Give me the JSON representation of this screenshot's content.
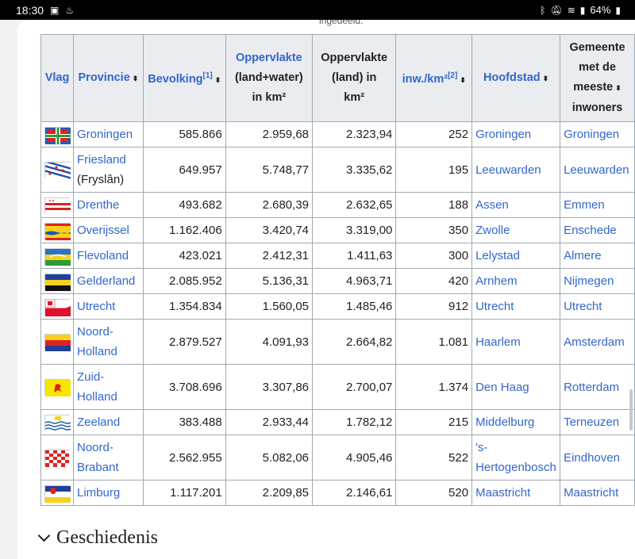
{
  "status_bar": {
    "time": "18:30",
    "battery": "64%"
  },
  "top_note": "ingedeeld.",
  "table": {
    "headers": {
      "vlag": "Vlag",
      "provincie": "Provincie",
      "bevolking": "Bevolking",
      "bevolking_ref": "[1]",
      "opp_total_1": "Oppervlakte",
      "opp_total_2": "(land+water)",
      "opp_total_3": "in km²",
      "opp_land_1": "Oppervlakte",
      "opp_land_2": "(land) in",
      "opp_land_3": "km²",
      "dichtheid": "inw./km²",
      "dichtheid_ref": "[2]",
      "hoofdstad": "Hoofdstad",
      "gemeente_1": "Gemeente",
      "gemeente_2": "met de",
      "gemeente_3": "meeste",
      "gemeente_4": "inwoners",
      "sort": "⬍"
    },
    "rows": [
      {
        "province": "Groningen",
        "province2": "",
        "pop": "585.866",
        "area_total": "2.959,68",
        "area_land": "2.323,94",
        "density": "252",
        "capital": "Groningen",
        "capital2": "",
        "largest": "Groningen"
      },
      {
        "province": "Friesland",
        "province2": "(Fryslân)",
        "pop": "649.957",
        "area_total": "5.748,77",
        "area_land": "3.335,62",
        "density": "195",
        "capital": "Leeuwarden",
        "capital2": "",
        "largest": "Leeuwarden"
      },
      {
        "province": "Drenthe",
        "province2": "",
        "pop": "493.682",
        "area_total": "2.680,39",
        "area_land": "2.632,65",
        "density": "188",
        "capital": "Assen",
        "capital2": "",
        "largest": "Emmen"
      },
      {
        "province": "Overijssel",
        "province2": "",
        "pop": "1.162.406",
        "area_total": "3.420,74",
        "area_land": "3.319,00",
        "density": "350",
        "capital": "Zwolle",
        "capital2": "",
        "largest": "Enschede"
      },
      {
        "province": "Flevoland",
        "province2": "",
        "pop": "423.021",
        "area_total": "2.412,31",
        "area_land": "1.411,63",
        "density": "300",
        "capital": "Lelystad",
        "capital2": "",
        "largest": "Almere"
      },
      {
        "province": "Gelderland",
        "province2": "",
        "pop": "2.085.952",
        "area_total": "5.136,31",
        "area_land": "4.963,71",
        "density": "420",
        "capital": "Arnhem",
        "capital2": "",
        "largest": "Nijmegen"
      },
      {
        "province": "Utrecht",
        "province2": "",
        "pop": "1.354.834",
        "area_total": "1.560,05",
        "area_land": "1.485,46",
        "density": "912",
        "capital": "Utrecht",
        "capital2": "",
        "largest": "Utrecht"
      },
      {
        "province": "Noord-",
        "province2": "Holland",
        "pop": "2.879.527",
        "area_total": "4.091,93",
        "area_land": "2.664,82",
        "density": "1.081",
        "capital": "Haarlem",
        "capital2": "",
        "largest": "Amsterdam"
      },
      {
        "province": "Zuid-",
        "province2": "Holland",
        "pop": "3.708.696",
        "area_total": "3.307,86",
        "area_land": "2.700,07",
        "density": "1.374",
        "capital": "Den Haag",
        "capital2": "",
        "largest": "Rotterdam"
      },
      {
        "province": "Zeeland",
        "province2": "",
        "pop": "383.488",
        "area_total": "2.933,44",
        "area_land": "1.782,12",
        "density": "215",
        "capital": "Middelburg",
        "capital2": "",
        "largest": "Terneuzen"
      },
      {
        "province": "Noord-",
        "province2": "Brabant",
        "pop": "2.562.955",
        "area_total": "5.082,06",
        "area_land": "4.905,46",
        "density": "522",
        "capital": "'s-",
        "capital2": "Hertogenbosch",
        "largest": "Eindhoven"
      },
      {
        "province": "Limburg",
        "province2": "",
        "pop": "1.117.201",
        "area_total": "2.209,85",
        "area_land": "2.146,61",
        "density": "520",
        "capital": "Maastricht",
        "capital2": "",
        "largest": "Maastricht"
      }
    ]
  },
  "section": {
    "title": "Geschiedenis"
  },
  "colors": {
    "link": "#3366cc",
    "header_bg": "#eaecf0",
    "border": "#a2a9b1"
  },
  "icons": {
    "flags": "province-flag-icon",
    "section_toggle": "chevron-down-icon"
  }
}
